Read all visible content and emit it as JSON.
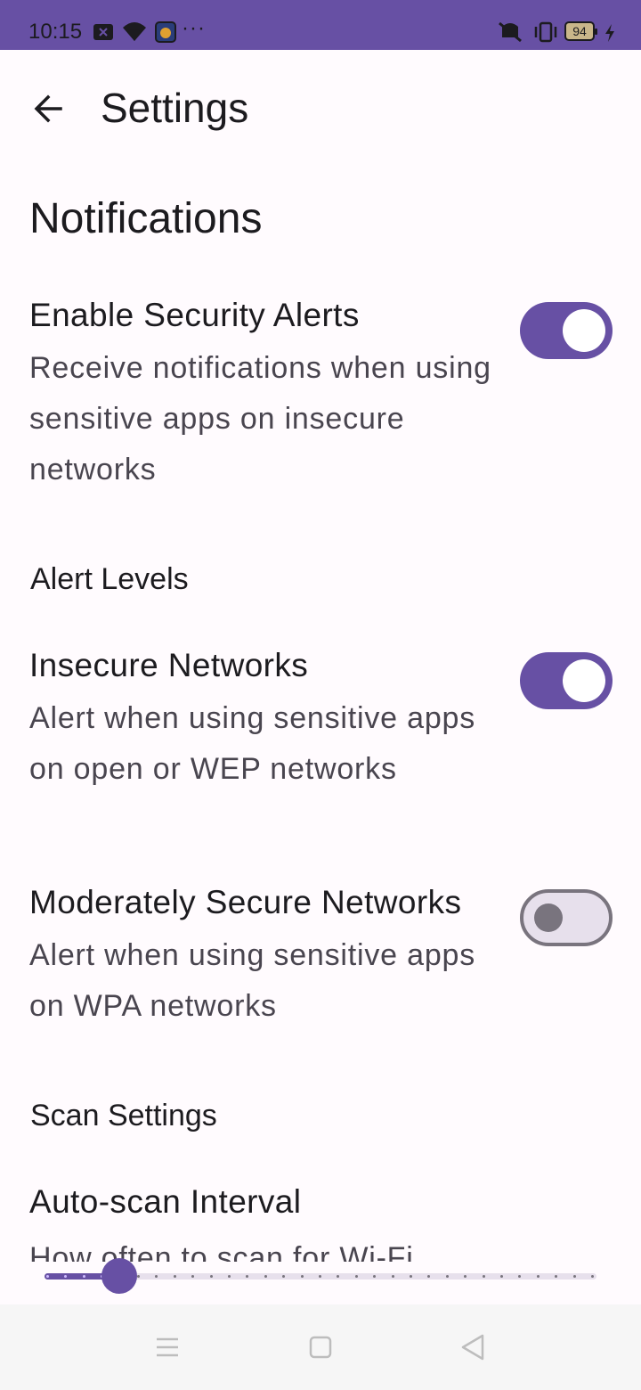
{
  "status_bar": {
    "time": "10:15",
    "battery": "94",
    "more": "···",
    "icons": [
      "notification-x-icon",
      "wifi-icon",
      "app-icon",
      "vibrate-off-icon",
      "vibrate-icon",
      "battery-icon",
      "charging-icon"
    ]
  },
  "header": {
    "title": "Settings",
    "back_icon": "arrow-back-icon"
  },
  "notifications": {
    "heading": "Notifications",
    "enable_alerts": {
      "title": "Enable Security Alerts",
      "summary": "Receive notifications when using sensitive apps on insecure networks",
      "checked": true
    }
  },
  "alert_levels": {
    "heading": "Alert Levels",
    "insecure": {
      "title": "Insecure Networks",
      "summary": "Alert when using sensitive apps on open or WEP networks",
      "checked": true
    },
    "moderate": {
      "title": "Moderately Secure Networks",
      "summary": "Alert when using sensitive apps on WPA networks",
      "checked": false
    }
  },
  "scan_settings": {
    "heading": "Scan Settings",
    "auto_scan": {
      "title": "Auto-scan Interval",
      "summary": "How often to scan for Wi-Fi",
      "slider_fraction": 0.135
    }
  },
  "nav_bar": {
    "buttons": [
      "menu-icon",
      "home-icon",
      "back-triangle-icon"
    ]
  },
  "colors": {
    "accent": "#6750A4",
    "background": "#FFFBFE",
    "text": "#1C1B1F",
    "secondary_text": "#49454F"
  }
}
